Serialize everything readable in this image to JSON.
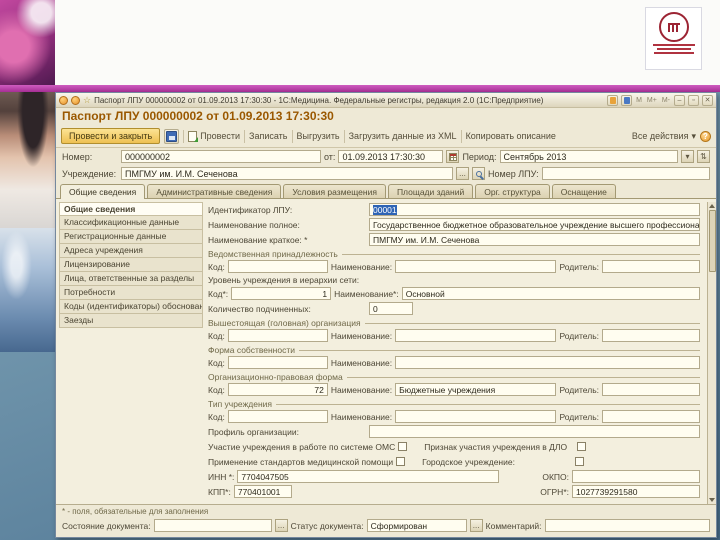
{
  "colors": {
    "accent_stripe": "#b43fae",
    "selection": "#2e64b5",
    "caption_text": "#9a5800",
    "primary_button": "#eec052"
  },
  "icons": {
    "star": "☆",
    "dropdown": "▾",
    "spin": "⇅",
    "min": "–",
    "max": "▫",
    "close": "✕",
    "mem1": "М",
    "mem2": "М+",
    "mem3": "М-",
    "help": "?",
    "ellipsis": "...",
    "all_actions_arrow": "▾"
  },
  "window": {
    "title": "Паспорт ЛПУ 000000002 от 01.09.2013 17:30:30 - 1С:Медицина. Федеральные регистры, редакция 2.0 (1С:Предприятие)",
    "caption": "Паспорт ЛПУ 000000002 от 01.09.2013 17:30:30",
    "toolbar": {
      "post_close": "Провести и закрыть",
      "post": "Провести",
      "write": "Записать",
      "unload": "Выгрузить",
      "load_xml": "Загрузить данные из XML",
      "copy_desc": "Копировать описание",
      "all_actions": "Все действия"
    },
    "header": {
      "number_label": "Номер:",
      "number": "000000002",
      "date_label": "от:",
      "date": "01.09.2013 17:30:30",
      "period_label": "Период:",
      "period": "Сентябрь 2013",
      "org_label": "Учреждение:",
      "org": "ПМГМУ им. И.М. Сеченова",
      "lpu_label": "Номер ЛПУ:",
      "lpu": ""
    },
    "tabs": [
      {
        "label": "Общие сведения"
      },
      {
        "label": "Административные сведения"
      },
      {
        "label": "Условия размещения"
      },
      {
        "label": "Площади зданий"
      },
      {
        "label": "Орг. структура"
      },
      {
        "label": "Оснащение"
      }
    ],
    "sidebar": [
      {
        "label": "Общие сведения"
      },
      {
        "label": "Классификационные данные"
      },
      {
        "label": "Регистрационные данные"
      },
      {
        "label": "Адреса учреждения"
      },
      {
        "label": "Лицензирование"
      },
      {
        "label": "Лица, ответственные за разделы"
      },
      {
        "label": "Потребности"
      },
      {
        "label": "Коды (идентификаторы) обоснований"
      },
      {
        "label": "Заезды"
      }
    ],
    "form": {
      "identifier_label": "Идентификатор ЛПУ:",
      "identifier": "00001",
      "full_name_label": "Наименование полное:",
      "full_name": "Государственное бюджетное образовательное учреждение высшего профессионального образова",
      "short_name_label": "Наименование краткое: *",
      "short_name": "ПМГМУ им. И.М. Сеченова",
      "labels": {
        "code": "Код:",
        "code_req": "Код*:",
        "name": "Наименование:",
        "name_req": "Наименование*:",
        "parent": "Родитель:"
      },
      "groups": {
        "dept": {
          "title": "Ведомственная принадлежность",
          "code": "",
          "name": "",
          "parent": ""
        },
        "head_org": {
          "title": "Вышестоящая (головная) организация",
          "code": "",
          "name": "",
          "parent": ""
        },
        "ownership": {
          "title": "Форма собственности",
          "code": "",
          "name": ""
        },
        "legal_form": {
          "title": "Организационно-правовая форма",
          "code": "72",
          "name": "Бюджетные учреждения",
          "parent": ""
        },
        "org_type": {
          "title": "Тип учреждения",
          "code": "",
          "name": "",
          "parent": ""
        }
      },
      "level_label": "Уровень учреждения в иерархии сети:",
      "level_code": "1",
      "level_name": "Основной",
      "subordinate_label": "Количество подчиненных:",
      "subordinate_count": "0",
      "profile_label": "Профиль организации:",
      "profile": "",
      "cb_oms": "Участие учреждения в работе по системе ОМС",
      "cb_dlo": "Признак участия учреждения в ДЛО",
      "cb_standards": "Применение стандартов медицинской помощи",
      "cb_city": "Городское учреждение:",
      "inn_label": "ИНН *:",
      "inn": "7704047505",
      "okpo_label": "ОКПО:",
      "okpo": "",
      "kpp_label": "КПП*:",
      "kpp": "770401001",
      "ogrn_label": "ОГРН*:",
      "ogrn": "1027739291580"
    },
    "footer": {
      "note": "* - поля, обязательные для заполнения",
      "state_label": "Состояние документа:",
      "state": "",
      "status_label": "Статус документа:",
      "status": "Сформирован",
      "comment_label": "Комментарий:",
      "comment": ""
    }
  }
}
